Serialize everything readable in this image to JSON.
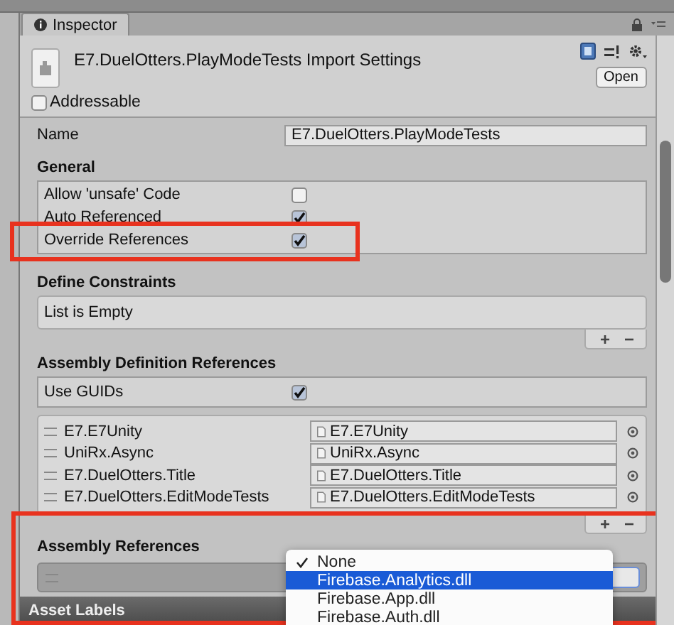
{
  "window": {
    "tab": "Inspector"
  },
  "header": {
    "title": "E7.DuelOtters.PlayModeTests Import Settings",
    "open_button": "Open",
    "addressable": {
      "label": "Addressable",
      "checked": false
    }
  },
  "name": {
    "label": "Name",
    "value": "E7.DuelOtters.PlayModeTests"
  },
  "general": {
    "heading": "General",
    "options": [
      {
        "label": "Allow 'unsafe' Code",
        "checked": false,
        "highlighted": false
      },
      {
        "label": "Auto Referenced",
        "checked": true,
        "highlighted": false
      },
      {
        "label": "Override References",
        "checked": true,
        "highlighted": true
      }
    ]
  },
  "define_constraints": {
    "heading": "Define Constraints",
    "empty_text": "List is Empty",
    "add": "+",
    "remove": "−"
  },
  "assembly_definition_references": {
    "heading": "Assembly Definition References",
    "use_guids": {
      "label": "Use GUIDs",
      "checked": true
    },
    "items": [
      {
        "label": "E7.E7Unity",
        "value": "E7.E7Unity"
      },
      {
        "label": "UniRx.Async",
        "value": "UniRx.Async"
      },
      {
        "label": "E7.DuelOtters.Title",
        "value": "E7.DuelOtters.Title"
      },
      {
        "label": "E7.DuelOtters.EditModeTests",
        "value": "E7.DuelOtters.EditModeTests"
      }
    ],
    "add": "+",
    "remove": "−"
  },
  "assembly_references": {
    "heading": "Assembly References",
    "highlighted": true,
    "dropdown": {
      "options": [
        {
          "label": "None",
          "selected": true,
          "hovered": false
        },
        {
          "label": "Firebase.Analytics.dll",
          "selected": false,
          "hovered": true
        },
        {
          "label": "Firebase.App.dll",
          "selected": false,
          "hovered": false
        },
        {
          "label": "Firebase.Auth.dll",
          "selected": false,
          "hovered": false
        }
      ]
    }
  },
  "asset_labels": {
    "label": "Asset Labels"
  }
}
